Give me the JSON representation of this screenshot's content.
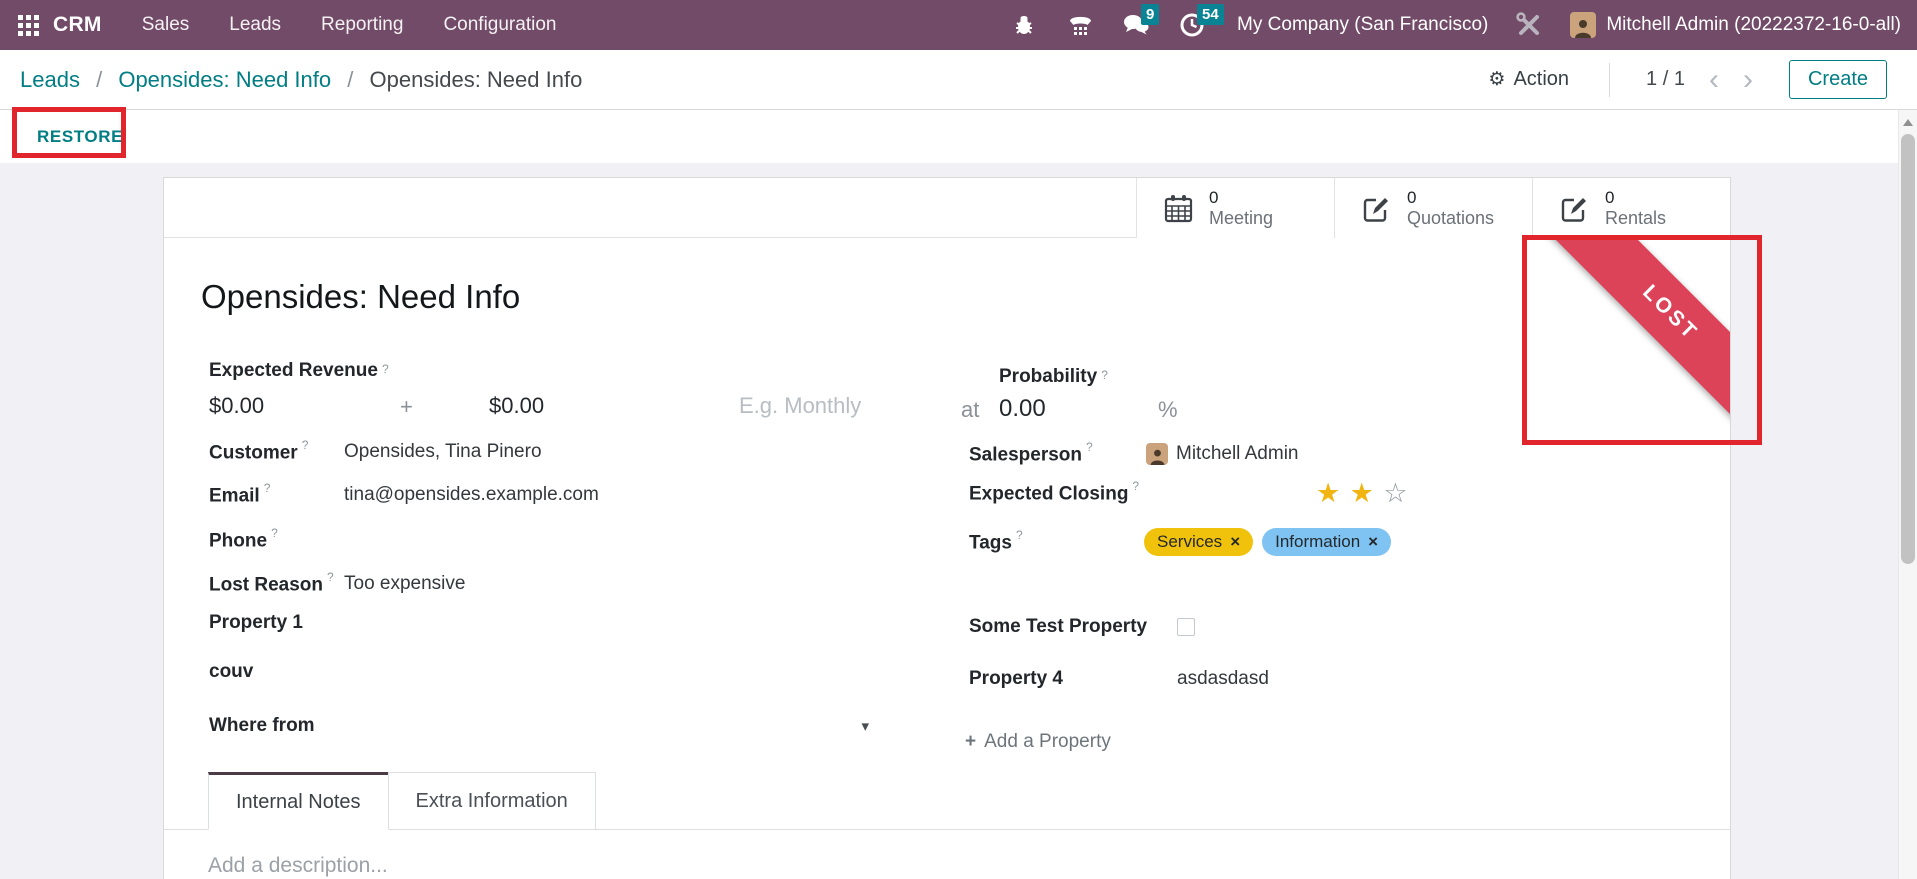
{
  "nav": {
    "app_name": "CRM",
    "menus": [
      "Sales",
      "Leads",
      "Reporting",
      "Configuration"
    ],
    "badges": {
      "messages": "9",
      "activities": "54"
    },
    "company": "My Company (San Francisco)",
    "user": "Mitchell Admin (20222372-16-0-all)"
  },
  "breadcrumb": {
    "separator": "/",
    "items": [
      "Leads",
      "Opensides: Need Info",
      "Opensides: Need Info"
    ]
  },
  "control_panel": {
    "action_label": "Action",
    "pager": "1 / 1",
    "create_label": "Create",
    "restore_label": "RESTORE"
  },
  "stat_buttons": [
    {
      "value": "0",
      "label": "Meeting",
      "icon": "calendar-icon"
    },
    {
      "value": "0",
      "label": "Quotations",
      "icon": "edit-icon"
    },
    {
      "value": "0",
      "label": "Rentals",
      "icon": "edit-icon"
    }
  ],
  "ribbon": {
    "label": "LOST",
    "color": "#dc4358"
  },
  "record": {
    "title": "Opensides: Need Info",
    "help_marker": "?",
    "left": {
      "expected_revenue": {
        "label": "Expected Revenue",
        "amount": "$0.00",
        "plus": "+",
        "recurring_amount": "$0.00",
        "recurring_placeholder": "E.g. Monthly"
      },
      "customer": {
        "label": "Customer",
        "value": "Opensides, Tina Pinero"
      },
      "email": {
        "label": "Email",
        "value": "tina@opensides.example.com"
      },
      "phone": {
        "label": "Phone",
        "value": ""
      },
      "lost_reason": {
        "label": "Lost Reason",
        "value": "Too expensive"
      },
      "property1": {
        "label": "Property 1",
        "value": ""
      },
      "couv": {
        "label": "couv",
        "value": ""
      },
      "where_from": {
        "label": "Where from",
        "value": ""
      }
    },
    "right": {
      "probability": {
        "label": "Probability",
        "prefix": "at",
        "value": "0.00",
        "suffix": "%"
      },
      "salesperson": {
        "label": "Salesperson",
        "value": "Mitchell Admin"
      },
      "expected_closing": {
        "label": "Expected Closing",
        "stars": [
          "★",
          "★",
          "☆"
        ],
        "rating": "2 of 3"
      },
      "tags": {
        "label": "Tags",
        "items": [
          {
            "name": "Services",
            "color": "#f0c20c"
          },
          {
            "name": "Information",
            "color": "#7ec3f2"
          }
        ]
      },
      "some_test_property": {
        "label": "Some Test Property",
        "checked": false
      },
      "property4": {
        "label": "Property 4",
        "value": "asdasdasd"
      },
      "add_property_label": "Add a Property"
    }
  },
  "tabs": [
    {
      "label": "Internal Notes",
      "active": true
    },
    {
      "label": "Extra Information",
      "active": false
    }
  ],
  "notes_placeholder": "Add a description...",
  "icons": {
    "gear": "⚙",
    "chevron_left": "‹",
    "chevron_right": "›",
    "caret": "▾",
    "close": "×",
    "plus": "+"
  },
  "colors": {
    "nav": "#714B67",
    "link": "#017e84",
    "ribbon": "#dc4358",
    "annotation": "#e0262c",
    "badge": "#0a8394",
    "star": "#f1b511",
    "tag_yellow": "#f0c20c",
    "tag_blue": "#7ec3f2"
  }
}
